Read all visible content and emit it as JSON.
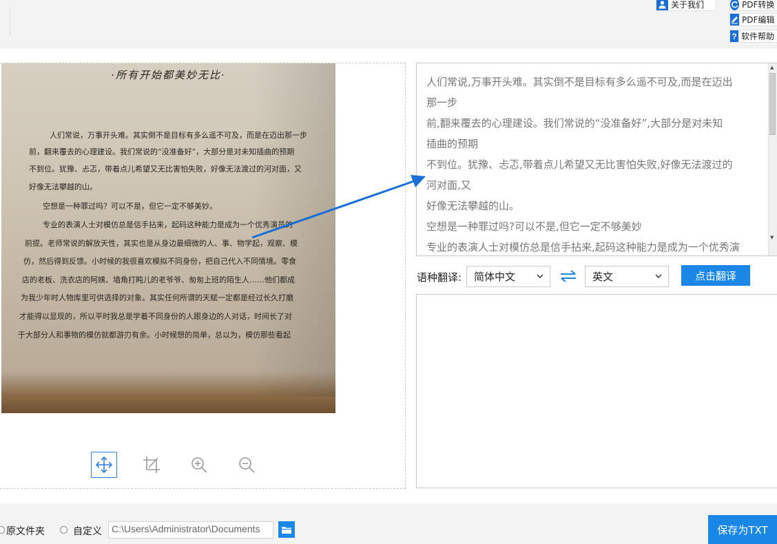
{
  "toolbar": {
    "about_label": "关于我们",
    "pdf_convert_label": "PDF转换",
    "pdf_edit_label": "PDF编辑",
    "help_label": "软件帮助"
  },
  "image_panel": {
    "photo_title": "·所有开始都美妙无比·",
    "photo_lines": [
      "人们常说，万事开头难。其实倒不是目标有多么遥不可及，而是在迈出那一步",
      "前，翻来覆去的心理建设。我们常说的“没准备好”，大部分是对未知插曲的预期",
      "不到位。犹豫、忐忑，带着点儿希望又无比害怕失败，好像无法渡过的河对面，又",
      "好像无法攀越的山。",
      "空想是一种罪过吗？可以不是，但它一定不够美妙。",
      "专业的表演人士对模仿总是信手拈来，起码这种能力是成为一个优秀演员的",
      "前提。老师常说的解放天性，其实也是从身边最细微的人、事、物学起，观察、模",
      "仿，然后得到反馈。小时候的我很喜欢模拟不同身份，把自己代入不同情境。零食",
      "店的老板、洗衣店的阿姨、墙角打盹儿的老爷爷、匆匆上班的陌生人……他们都成",
      "为我少年时人物库里可供选择的对象。其实任何所谓的天赋一定都是经过长久打磨",
      "才能得以显现的，所以平时我总是学着不同身份的人跟身边的人对话，时间长了对",
      "于大部分人和事物的模仿就都游刃有余。小时候想的简单，总以为，模仿那些看起"
    ],
    "tools": [
      "move-icon",
      "crop-icon",
      "zoom-in-icon",
      "zoom-out-icon"
    ]
  },
  "ocr_text": {
    "lines": [
      "人们常说,万事开头难。其实倒不是目标有多么遥不可及,而是在迈出",
      "那一步",
      "前,翻来覆去的心理建设。我们常说的“没准备好”,大部分是对未知",
      "插曲的预期",
      "不到位。犹豫、忐忑,带着点儿希望又无比害怕失败,好像无法渡过的",
      "河对面,又",
      "好像无法攀越的山。",
      "空想是一种罪过吗?可以不是,但它一定不够美妙",
      "专业的表演人士对模仿总是信手拈来,起码这种能力是成为一个优秀演"
    ]
  },
  "translate": {
    "label": "语种翻译:",
    "source_lang": "简体中文",
    "target_lang": "英文",
    "button_label": "点击翻译"
  },
  "output": {
    "option_original_label": "原文件夹",
    "option_custom_label": "自定义",
    "path_value": "C:\\Users\\Administrator\\Documents",
    "save_button_label": "保存为TXT"
  },
  "colors": {
    "accent": "#1a86e6",
    "arrow": "#1a6fd6"
  }
}
